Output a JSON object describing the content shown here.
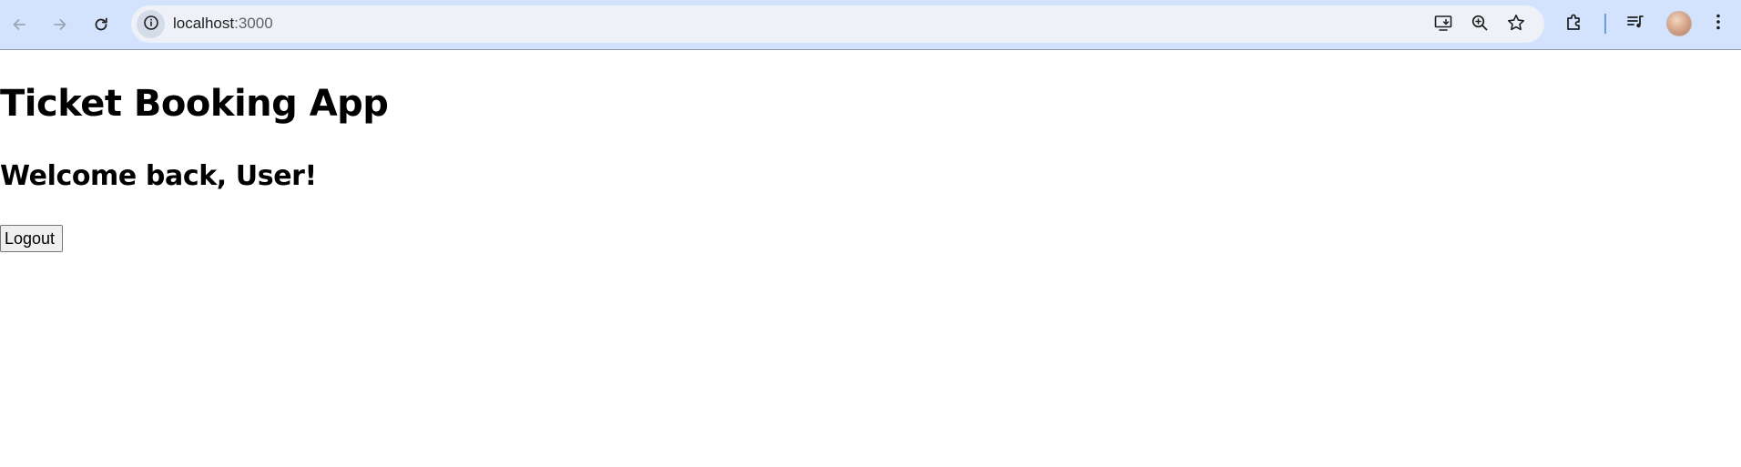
{
  "browser": {
    "url_host": "localhost",
    "url_port": ":3000",
    "icons": {
      "back": "back-arrow-icon",
      "forward": "forward-arrow-icon",
      "reload": "reload-icon",
      "site_info": "info-icon",
      "install": "install-app-icon",
      "zoom": "zoom-icon",
      "bookmark": "star-icon",
      "extensions": "puzzle-icon",
      "media": "media-controls-icon",
      "profile": "avatar",
      "menu": "kebab-menu-icon"
    },
    "colors": {
      "toolbar_bg": "#d3e3fd",
      "omnibox_bg": "#eef1f7",
      "divider": "#6f9be0"
    }
  },
  "page": {
    "title": "Ticket Booking App",
    "welcome": "Welcome back, User!",
    "logout_label": "Logout"
  }
}
